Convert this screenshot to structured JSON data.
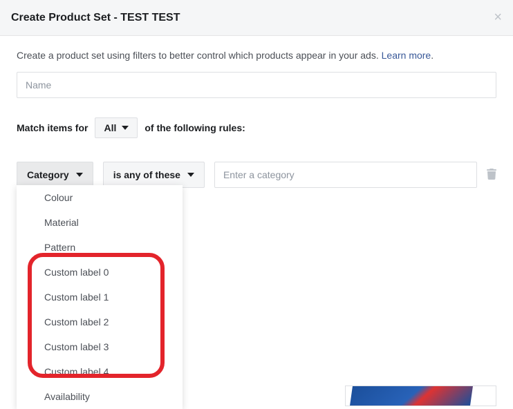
{
  "header": {
    "title": "Create Product Set - TEST TEST"
  },
  "description": {
    "text": "Create a product set using filters to better control which products appear in your ads. ",
    "link": "Learn more"
  },
  "name_input": {
    "placeholder": "Name",
    "value": ""
  },
  "match": {
    "prefix": "Match items for",
    "scope": "All",
    "suffix": "of the following rules:"
  },
  "rule": {
    "field": "Category",
    "operator": "is any of these",
    "value_placeholder": "Enter a category"
  },
  "dropdown": {
    "items": [
      "Colour",
      "Material",
      "Pattern",
      "Custom label 0",
      "Custom label 1",
      "Custom label 2",
      "Custom label 3",
      "Custom label 4",
      "Availability"
    ]
  }
}
